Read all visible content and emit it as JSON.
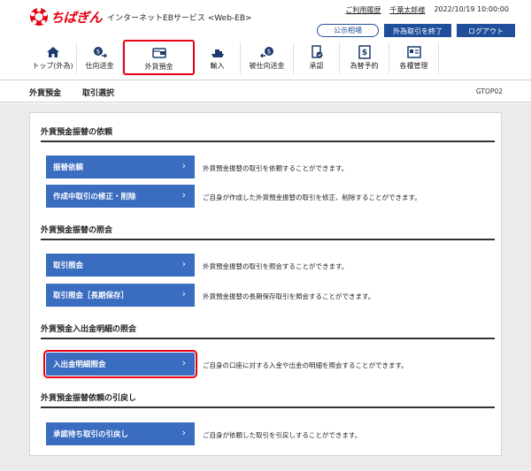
{
  "header": {
    "logo_text": "ちばぎん",
    "service_name": "インターネットEBサービス <Web-EB>",
    "help_link": "ご利用履歴",
    "user_name": "千葉太郎様",
    "datetime": "2022/10/19 10:00:00",
    "public_rate_button": "公示相場",
    "end_fx_button": "外為取引を終了",
    "logout_button": "ログアウト",
    "brand_color": "#e60012",
    "accent_color": "#1f4e9a"
  },
  "nav": {
    "items": [
      {
        "label": "トップ(外為)",
        "icon": "home-icon"
      },
      {
        "label": "仕向送金",
        "icon": "remittance-icon"
      },
      {
        "label": "外貨預金",
        "icon": "deposit-icon"
      },
      {
        "label": "輸入",
        "icon": "import-icon"
      },
      {
        "label": "被仕向送金",
        "icon": "incoming-remittance-icon"
      },
      {
        "label": "承認",
        "icon": "approval-icon"
      },
      {
        "label": "為替予約",
        "icon": "exchange-reservation-icon"
      },
      {
        "label": "各種管理",
        "icon": "management-icon"
      }
    ],
    "active_index": 2
  },
  "page": {
    "title": "外貨預金",
    "subtitle": "取引選択",
    "screen_code": "GTOP02"
  },
  "sections": [
    {
      "title": "外貨預金振替の依頼",
      "actions": [
        {
          "label": "振替依頼",
          "desc": "外貨預金振替の取引を依頼することができます。"
        },
        {
          "label": "作成中取引の修正・削除",
          "desc": "ご自身が作成した外貨預金振替の取引を修正、削除することができます。"
        }
      ]
    },
    {
      "title": "外貨預金振替の照会",
      "actions": [
        {
          "label": "取引照会",
          "desc": "外貨預金振替の取引を照会することができます。"
        },
        {
          "label": "取引照会［長期保存］",
          "desc": "外貨預金振替の長期保存取引を照会することができます。"
        }
      ]
    },
    {
      "title": "外貨預金入出金明細の照会",
      "actions": [
        {
          "label": "入出金明細照会",
          "desc": "ご自身の口座に対する入金や出金の明細を照会することができます。"
        }
      ]
    },
    {
      "title": "外貨預金振替依頼の引戻し",
      "actions": [
        {
          "label": "承認待ち取引の引戻し",
          "desc": "ご自身が依頼した取引を引戻しすることができます。"
        }
      ]
    }
  ],
  "chevron": "›"
}
